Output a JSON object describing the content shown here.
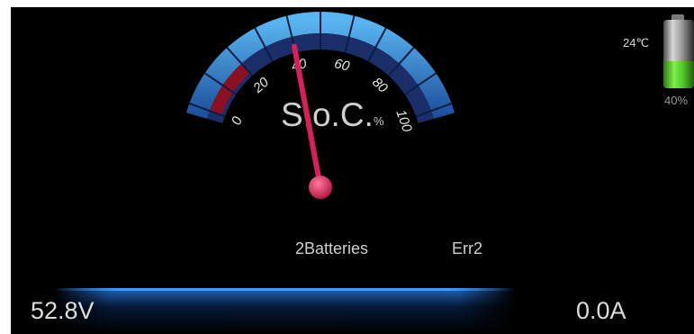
{
  "gauge": {
    "title": "S.o.C.",
    "unit": "%",
    "min": 0,
    "max": 100,
    "value": 40,
    "tick_labels": [
      "0",
      "20",
      "40",
      "60",
      "80",
      "100"
    ],
    "needle_color": "#d81e5b",
    "arc_color": "#3a8fd8",
    "low_zone_color": "#8a1022"
  },
  "battery": {
    "temperature": "24℃",
    "percent_label": "40%",
    "level": 0.4,
    "fill_color": "#4cc52a"
  },
  "status": {
    "batteries": "2Batteries",
    "error": "Err2"
  },
  "readings": {
    "voltage": "52.8V",
    "current": "0.0A"
  }
}
